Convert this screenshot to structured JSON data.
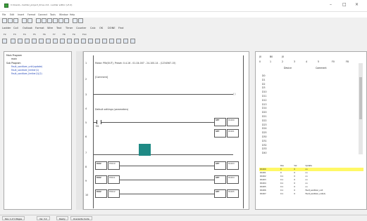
{
  "window": {
    "title": "C:\\Users\\...\\ladder_project_drive.c12 - Ladder editor (v3.2)",
    "minimize": "–",
    "maximize": "□",
    "close": "×"
  },
  "menu": [
    "File",
    "Edit",
    "Insert",
    "Format",
    "Connect",
    "Tools",
    "Window",
    "Help"
  ],
  "toolbar2": [
    "Ladder",
    "Coil",
    "Outlook",
    "Format",
    "Wire",
    "Text",
    "Timer",
    "Counter",
    "Calc",
    "OK",
    "DONE",
    "Find"
  ],
  "toolbar3": [
    "F2",
    "F3",
    "F4",
    "F5",
    "F6",
    "F7",
    "F8",
    "F9",
    "F10"
  ],
  "tree": {
    "root_label": "Main Program",
    "root_child": "main",
    "sub_label": "Sub Program",
    "sub_items": [
      "Fault_sanitizer_unit(update)",
      "Fault_sanitizer_limiter(1)",
      "Fault_sanitizer_limiter(1)(2)"
    ]
  },
  "ladder": {
    "rungs": [
      {
        "num": "1",
        "text": "Motor: PIN(OUT), Preset: 0.4-16 - 01-04-007 - 24-100-14 - (1234567-15)"
      },
      {
        "num": "2",
        "text": "[Comment]"
      },
      {
        "num": "3",
        "coil_label": "( )"
      },
      {
        "num": "4",
        "text": "Default settings (parameters)"
      },
      {
        "num": "5",
        "contact_label": "M1"
      },
      {
        "num": "6"
      },
      {
        "num": "7"
      },
      {
        "num": "8"
      },
      {
        "num": "9"
      },
      {
        "num": "10"
      }
    ],
    "blocks": {
      "r5a_tag": "SET",
      "r5a_val": "D1000",
      "r5b_tag": "SET",
      "r5b_val": "D1001",
      "r6_tag": "SET",
      "r6_val": "D1002",
      "r8l_tag": "MOV",
      "r8l_val": "D5010",
      "r8r_tag": "SET",
      "r8r_val": "D1003",
      "r9l_tag": "MOV",
      "r9l_val": "D5011",
      "r9r_tag": "SET",
      "r9r_val": "D1004",
      "r10l_tag": "MOV",
      "r10l_val": "D5012",
      "r10r_tag": "SET",
      "r10r_val": "D1005"
    }
  },
  "devices": {
    "headers_top": [
      "J0",
      "B0",
      "J0",
      "0",
      "1",
      "2",
      "3",
      "4",
      "5",
      "F0",
      "F8"
    ],
    "col_device": "Device",
    "col_comment": "Comment",
    "list": [
      "D0",
      "D1",
      "D2",
      "D3",
      "D10",
      "D11",
      "D12",
      "D13",
      "D14",
      "D20",
      "D21",
      "D22",
      "D23",
      "D24",
      "D25",
      "D30",
      "D31",
      "D32",
      "D33",
      "D40"
    ]
  },
  "watch": {
    "headers": [
      "",
      "Dev",
      "Val",
      "Update"
    ],
    "rows": [
      [
        "D1000",
        "0",
        "0",
        "no",
        "hi"
      ],
      [
        "D1001",
        "0",
        "0",
        "no",
        ""
      ],
      [
        "D1002",
        "0.1",
        "0",
        "no",
        ""
      ],
      [
        "D1003",
        "0.1",
        "0",
        "no",
        ""
      ],
      [
        "D1004",
        "0.1",
        "0",
        "no",
        ""
      ],
      [
        "D1005",
        "0.1",
        "0",
        "no",
        ""
      ],
      [
        "D1006",
        "0.1",
        "0",
        "Fault_sanitizer_unit",
        ""
      ],
      [
        "D1007",
        "0.1",
        "0",
        "Fault_sanitizer_unit(2)",
        ""
      ]
    ]
  },
  "status": [
    "Rev: 1 of 4 Pages",
    "Ver. 3.2",
    "Ready",
    "Overwrite mode"
  ],
  "colors": {
    "teal": "#1f8a85",
    "highlight": "#fff866"
  }
}
